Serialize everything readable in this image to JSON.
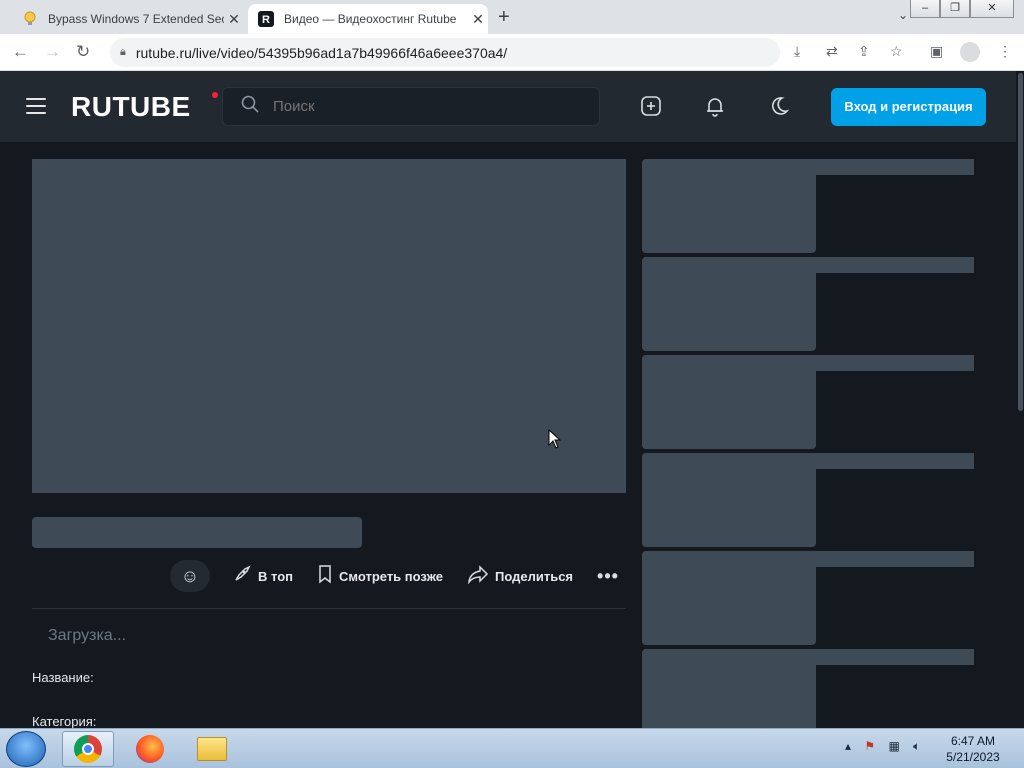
{
  "browser": {
    "tabs": [
      {
        "title": "Bypass Windows 7 Extended Sec",
        "icon": "lightbulb-icon",
        "active": false
      },
      {
        "title": "Видео — Видеохостинг Rutube",
        "icon": "rutube-r-icon",
        "active": true
      }
    ],
    "new_tab": "+",
    "url": "rutube.ru/live/video/54395b96ad1a7b49966f46a6eee370a4/"
  },
  "site": {
    "logo": "RUTUBE",
    "search_placeholder": "Поиск",
    "login_button": "Вход и регистрация",
    "accent_color": "#00a1e7"
  },
  "video": {
    "actions": {
      "top": "В топ",
      "watch_later": "Смотреть позже",
      "share": "Поделиться"
    },
    "loading": "Загрузка...",
    "name_label": "Название:",
    "category_label": "Категория:"
  },
  "taskbar": {
    "time": "6:47 AM",
    "date": "5/21/2023"
  }
}
